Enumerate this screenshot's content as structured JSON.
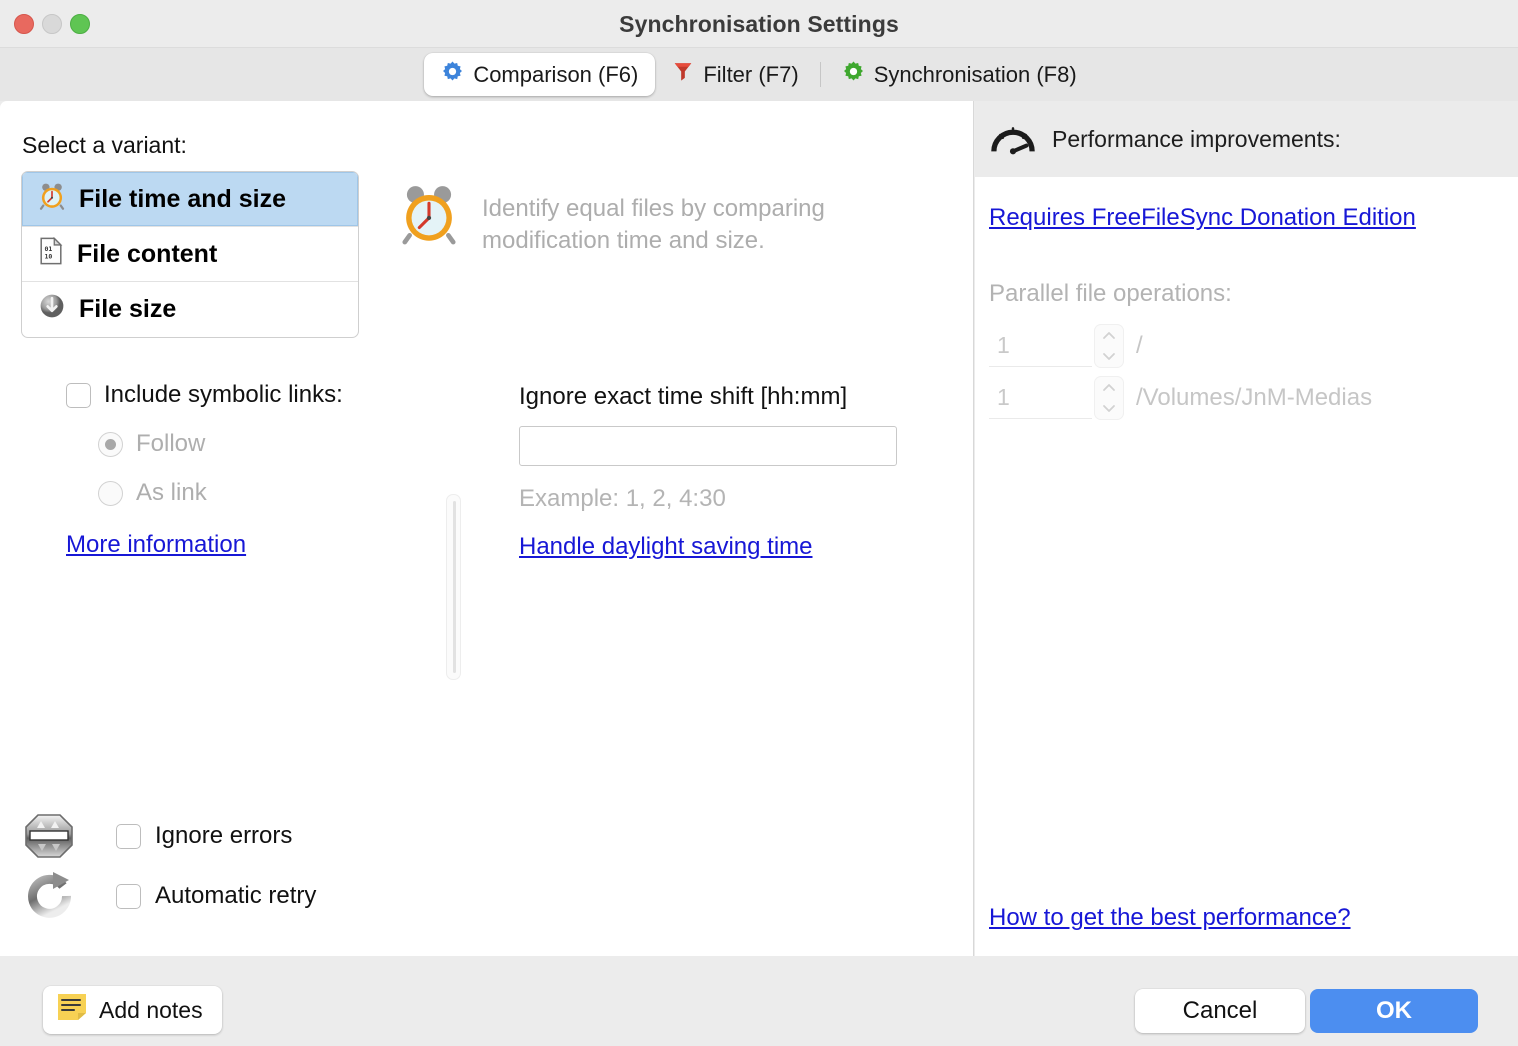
{
  "window": {
    "title": "Synchronisation Settings",
    "traffic_lights": [
      "close",
      "minimize",
      "maximize"
    ]
  },
  "tabs": [
    {
      "id": "comparison",
      "label": "Comparison (F6)",
      "icon": "blue-gear-icon",
      "active": true
    },
    {
      "id": "filter",
      "label": "Filter (F7)",
      "icon": "red-funnel-icon",
      "active": false
    },
    {
      "id": "synchronisation",
      "label": "Synchronisation (F8)",
      "icon": "green-gear-icon",
      "active": false
    }
  ],
  "comparison": {
    "variant_label": "Select a variant:",
    "variants": [
      {
        "id": "file-time-and-size",
        "label": "File time and size",
        "icon": "alarm-clock-icon",
        "selected": true
      },
      {
        "id": "file-content",
        "label": "File content",
        "icon": "binary-file-icon",
        "selected": false
      },
      {
        "id": "file-size",
        "label": "File size",
        "icon": "size-sphere-icon",
        "selected": false
      }
    ],
    "description": "Identify equal files by comparing modification time and size.",
    "description_icon": "alarm-clock-icon",
    "symbolic_links": {
      "checkbox_label": "Include symbolic links:",
      "checked": false,
      "options": [
        {
          "id": "follow",
          "label": "Follow",
          "selected": true,
          "disabled": true
        },
        {
          "id": "as-link",
          "label": "As link",
          "selected": false,
          "disabled": true
        }
      ],
      "more_information_link": "More information"
    },
    "time_shift": {
      "label": "Ignore exact time shift [hh:mm]",
      "value": "",
      "placeholder": "",
      "example": "Example: 1, 2, 4:30",
      "daylight_link": "Handle daylight saving time"
    },
    "bottom_options": [
      {
        "id": "ignore-errors",
        "label": "Ignore errors",
        "checked": false,
        "icon": "stop-sign-icon"
      },
      {
        "id": "automatic-retry",
        "label": "Automatic retry",
        "checked": false,
        "icon": "retry-circle-icon"
      }
    ]
  },
  "performance": {
    "header": "Performance improvements:",
    "header_icon": "speedometer-icon",
    "donation_link": "Requires FreeFileSync Donation Edition",
    "parallel_label": "Parallel file operations:",
    "spinners": [
      {
        "id": "parallel-left",
        "value": "1",
        "suffix": "/"
      },
      {
        "id": "parallel-right",
        "value": "1",
        "suffix": "/Volumes/JnM-Medias"
      }
    ],
    "best_performance_link": "How to get the best performance?"
  },
  "footer": {
    "add_notes_label": "Add notes",
    "add_notes_icon": "yellow-note-icon",
    "cancel_label": "Cancel",
    "ok_label": "OK"
  },
  "colors": {
    "accent_blue": "#4c8ef0",
    "link_blue": "#1717d6",
    "selection_blue": "#bcd9f2",
    "window_chrome": "#ececec",
    "panel_white": "#ffffff",
    "disabled_gray": "#b3b3b3"
  }
}
